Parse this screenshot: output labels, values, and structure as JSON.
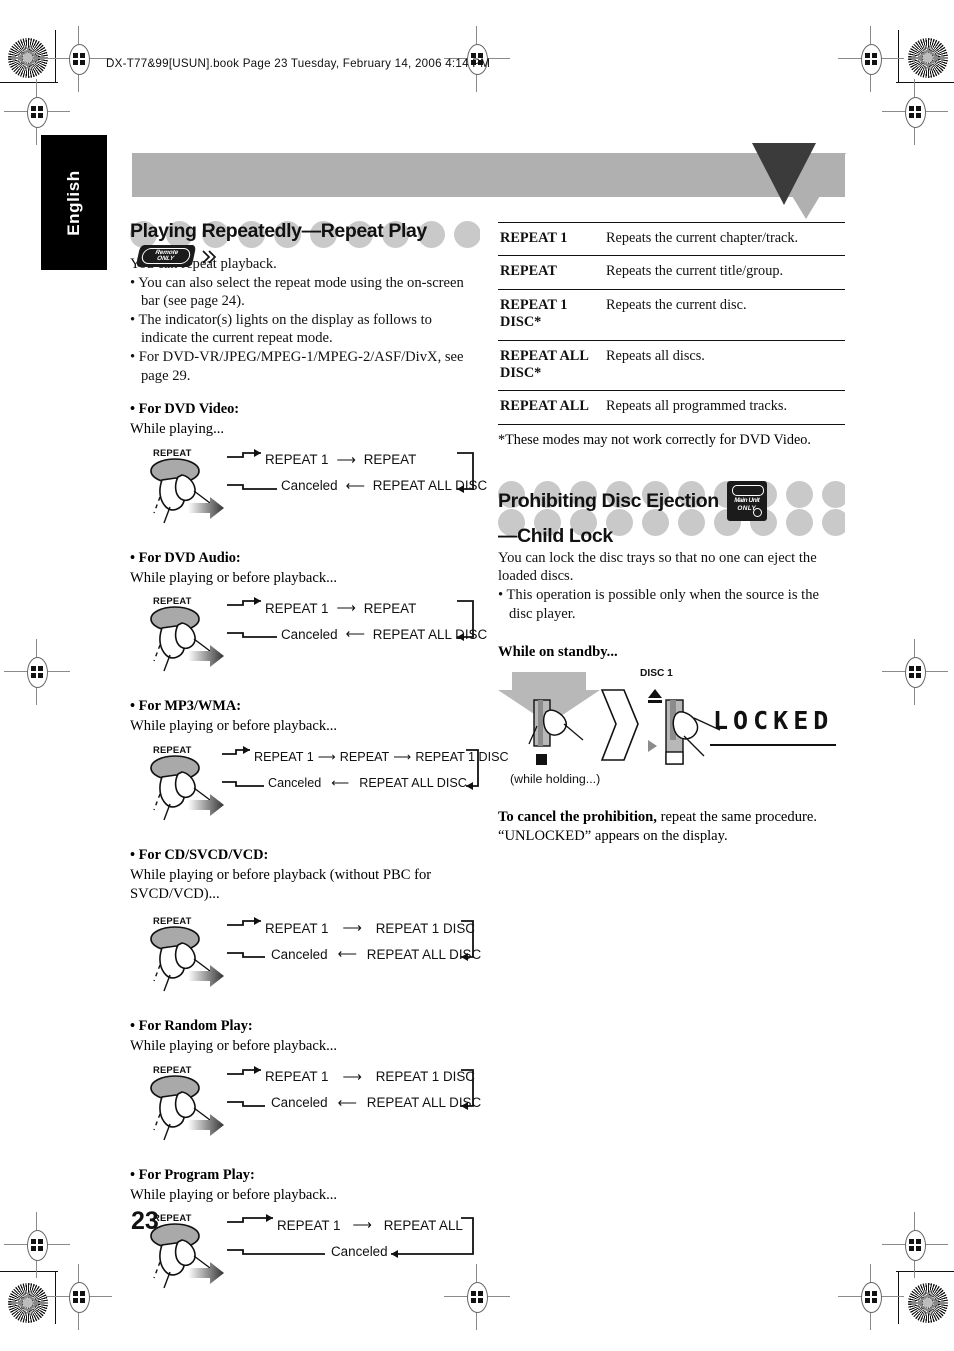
{
  "header": {
    "file_line": "DX-T77&99[USUN].book  Page 23  Tuesday, February 14, 2006  4:14 PM"
  },
  "language_tab": {
    "label": "English"
  },
  "page_number": "23",
  "left_column": {
    "title": "Playing Repeatedly—Repeat Play",
    "title_badge": {
      "line1": "Remote",
      "line2": "ONLY",
      "name": "remote-only-badge"
    },
    "intro": "You can repeat playback.",
    "bullets": [
      "You can also select the repeat mode using the on-screen bar (see page 24).",
      "The indicator(s) lights on the display as follows to indicate the current repeat mode.",
      "For DVD-VR/JPEG/MPEG-1/MPEG-2/ASF/DivX, see page 29."
    ],
    "sections": [
      {
        "heading": "For DVD Video:",
        "condition": "While playing...",
        "button_label": "REPEAT",
        "top_row": [
          "REPEAT 1",
          "REPEAT"
        ],
        "bottom_row": [
          "REPEAT ALL DISC",
          "Canceled"
        ]
      },
      {
        "heading": "For DVD Audio:",
        "condition": "While playing or before playback...",
        "button_label": "REPEAT",
        "top_row": [
          "REPEAT 1",
          "REPEAT"
        ],
        "bottom_row": [
          "REPEAT ALL DISC",
          "Canceled"
        ]
      },
      {
        "heading": "For MP3/WMA:",
        "condition": "While playing or before playback...",
        "button_label": "REPEAT",
        "top_row": [
          "REPEAT 1",
          "REPEAT",
          "REPEAT 1 DISC"
        ],
        "bottom_row": [
          "REPEAT ALL DISC",
          "Canceled"
        ]
      },
      {
        "heading": "For CD/SVCD/VCD:",
        "condition": "While playing or before playback (without PBC for SVCD/VCD)...",
        "button_label": "REPEAT",
        "top_row": [
          "REPEAT 1",
          "REPEAT 1 DISC"
        ],
        "bottom_row": [
          "REPEAT ALL DISC",
          "Canceled"
        ]
      },
      {
        "heading": "For Random Play:",
        "condition": "While playing or before playback...",
        "button_label": "REPEAT",
        "top_row": [
          "REPEAT 1",
          "REPEAT 1 DISC"
        ],
        "bottom_row": [
          "REPEAT ALL DISC",
          "Canceled"
        ]
      },
      {
        "heading": "For Program Play:",
        "condition": "While playing or before playback...",
        "button_label": "REPEAT",
        "top_row": [
          "REPEAT 1",
          "REPEAT ALL"
        ],
        "bottom_row": [
          "Canceled"
        ]
      }
    ]
  },
  "right_column": {
    "modes_table": {
      "rows": [
        {
          "mode": "REPEAT 1",
          "description": "Repeats the current chapter/track."
        },
        {
          "mode": "REPEAT",
          "description": "Repeats the current title/group."
        },
        {
          "mode": "REPEAT 1 DISC*",
          "description": "Repeats the current disc."
        },
        {
          "mode": "REPEAT ALL DISC*",
          "description": "Repeats all discs."
        },
        {
          "mode": "REPEAT ALL",
          "description": "Repeats all programmed tracks."
        }
      ],
      "footnote": "These modes may not work correctly for DVD Video."
    },
    "child_lock": {
      "title_line1": "Prohibiting Disc Ejection",
      "title_line2": "—Child Lock",
      "badge": {
        "line1": "Main Unit",
        "line2": "ONLY",
        "name": "main-unit-only-badge"
      },
      "intro": "You can lock the disc trays so that no one can eject the loaded discs.",
      "bullet": "This operation is possible only when the source is the disc player.",
      "standby_label": "While on standby...",
      "figure": {
        "hold_caption": "(while holding...)",
        "disc_label": "DISC 1",
        "display_text": "LOCKED"
      },
      "cancel_bold": "To cancel the prohibition,",
      "cancel_rest": " repeat the same procedure. “UNLOCKED” appears on the display."
    }
  }
}
